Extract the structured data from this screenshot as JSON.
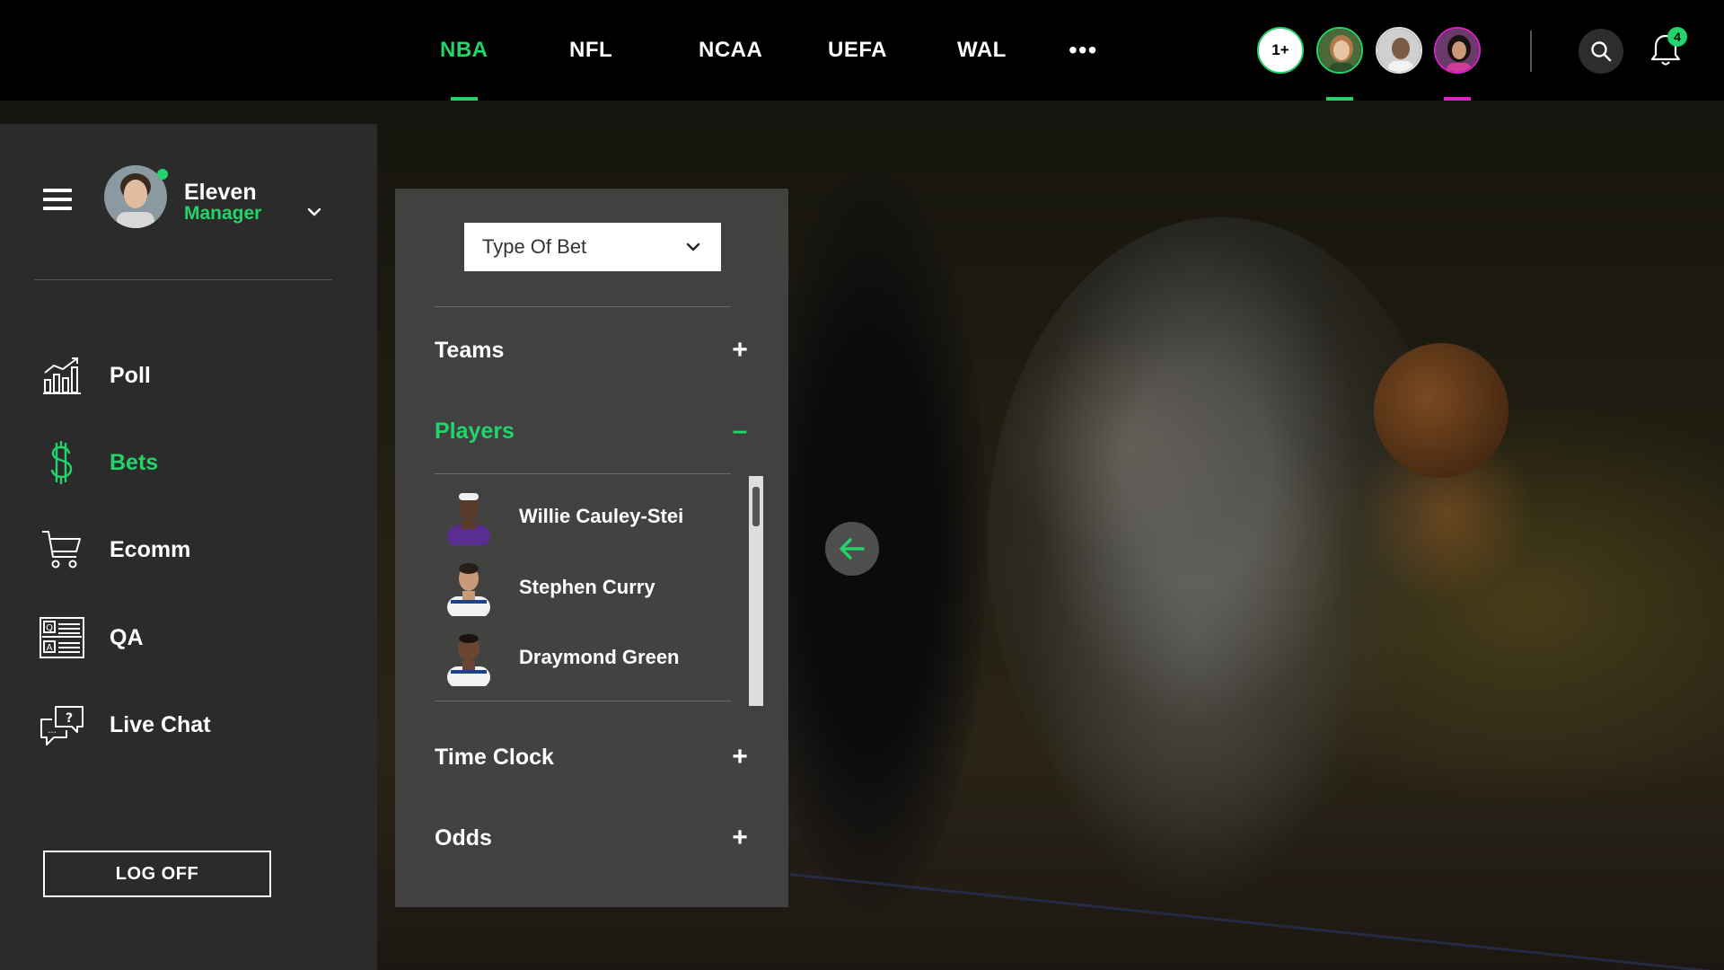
{
  "nav": {
    "tabs": [
      {
        "label": "NBA",
        "active": true
      },
      {
        "label": "NFL",
        "active": false
      },
      {
        "label": "NCAA",
        "active": false
      },
      {
        "label": "UEFA",
        "active": false
      },
      {
        "label": "WAL",
        "active": false
      }
    ],
    "more_label": "•••",
    "participants_more": "1+",
    "notifications_count": "4",
    "accent_color": "#22d46a",
    "highlight_color": "#e020c8"
  },
  "user": {
    "name": "Eleven",
    "role": "Manager",
    "status": "online"
  },
  "sidebar": {
    "items": [
      {
        "label": "Poll",
        "icon": "poll-chart-icon",
        "active": false
      },
      {
        "label": "Bets",
        "icon": "dollar-icon",
        "active": true
      },
      {
        "label": "Ecomm",
        "icon": "cart-icon",
        "active": false
      },
      {
        "label": "QA",
        "icon": "qa-icon",
        "active": false
      },
      {
        "label": "Live Chat",
        "icon": "chat-icon",
        "active": false
      }
    ],
    "logoff_label": "LOG OFF"
  },
  "panel": {
    "bet_type_select": "Type Of Bet",
    "sections": [
      {
        "label": "Teams",
        "toggle": "+",
        "open": false
      },
      {
        "label": "Players",
        "toggle": "–",
        "open": true
      },
      {
        "label": "Time Clock",
        "toggle": "+",
        "open": false
      },
      {
        "label": "Odds",
        "toggle": "+",
        "open": false
      }
    ],
    "players": [
      {
        "name": "Willie Cauley-Stei",
        "jersey_color": "#5a2d91"
      },
      {
        "name": "Stephen Curry",
        "jersey_color": "#1d428a"
      },
      {
        "name": "Draymond Green",
        "jersey_color": "#1d428a"
      }
    ]
  }
}
